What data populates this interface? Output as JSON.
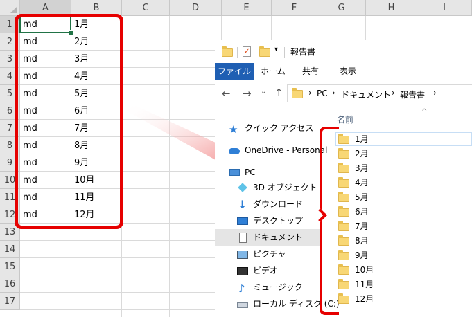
{
  "excel": {
    "columns": [
      "A",
      "B",
      "C",
      "D",
      "E",
      "F",
      "G",
      "H",
      "I"
    ],
    "rows": [
      "1",
      "2",
      "3",
      "4",
      "5",
      "6",
      "7",
      "8",
      "9",
      "10",
      "11",
      "12",
      "13",
      "14",
      "15",
      "16",
      "17"
    ],
    "cells": [
      {
        "a": "md",
        "b": "1月"
      },
      {
        "a": "md",
        "b": "2月"
      },
      {
        "a": "md",
        "b": "3月"
      },
      {
        "a": "md",
        "b": "4月"
      },
      {
        "a": "md",
        "b": "5月"
      },
      {
        "a": "md",
        "b": "6月"
      },
      {
        "a": "md",
        "b": "7月"
      },
      {
        "a": "md",
        "b": "8月"
      },
      {
        "a": "md",
        "b": "9月"
      },
      {
        "a": "md",
        "b": "10月"
      },
      {
        "a": "md",
        "b": "11月"
      },
      {
        "a": "md",
        "b": "12月"
      }
    ]
  },
  "explorer": {
    "title": "報告書",
    "tabs": [
      "ファイル",
      "ホーム",
      "共有",
      "表示"
    ],
    "breadcrumb": [
      "PC",
      "ドキュメント",
      "報告書"
    ],
    "column_header": "名前",
    "nav_items": [
      {
        "label": "クイック アクセス",
        "icon": "star-icon"
      },
      {
        "label": "OneDrive - Personal",
        "icon": "cloud-icon"
      },
      {
        "label": "PC",
        "icon": "pc-icon"
      },
      {
        "label": "3D オブジェクト",
        "icon": "cube-icon"
      },
      {
        "label": "ダウンロード",
        "icon": "download-icon"
      },
      {
        "label": "デスクトップ",
        "icon": "desktop-icon"
      },
      {
        "label": "ドキュメント",
        "icon": "document-icon"
      },
      {
        "label": "ピクチャ",
        "icon": "picture-icon"
      },
      {
        "label": "ビデオ",
        "icon": "video-icon"
      },
      {
        "label": "ミュージック",
        "icon": "music-icon"
      },
      {
        "label": "ローカル ディスク (C:)",
        "icon": "disk-icon"
      }
    ],
    "folders": [
      "1月",
      "2月",
      "3月",
      "4月",
      "5月",
      "6月",
      "7月",
      "8月",
      "9月",
      "10月",
      "11月",
      "12月"
    ]
  },
  "colors": {
    "highlight_red": "#e60000",
    "excel_green": "#217346",
    "explorer_blue": "#1f5fb3"
  }
}
